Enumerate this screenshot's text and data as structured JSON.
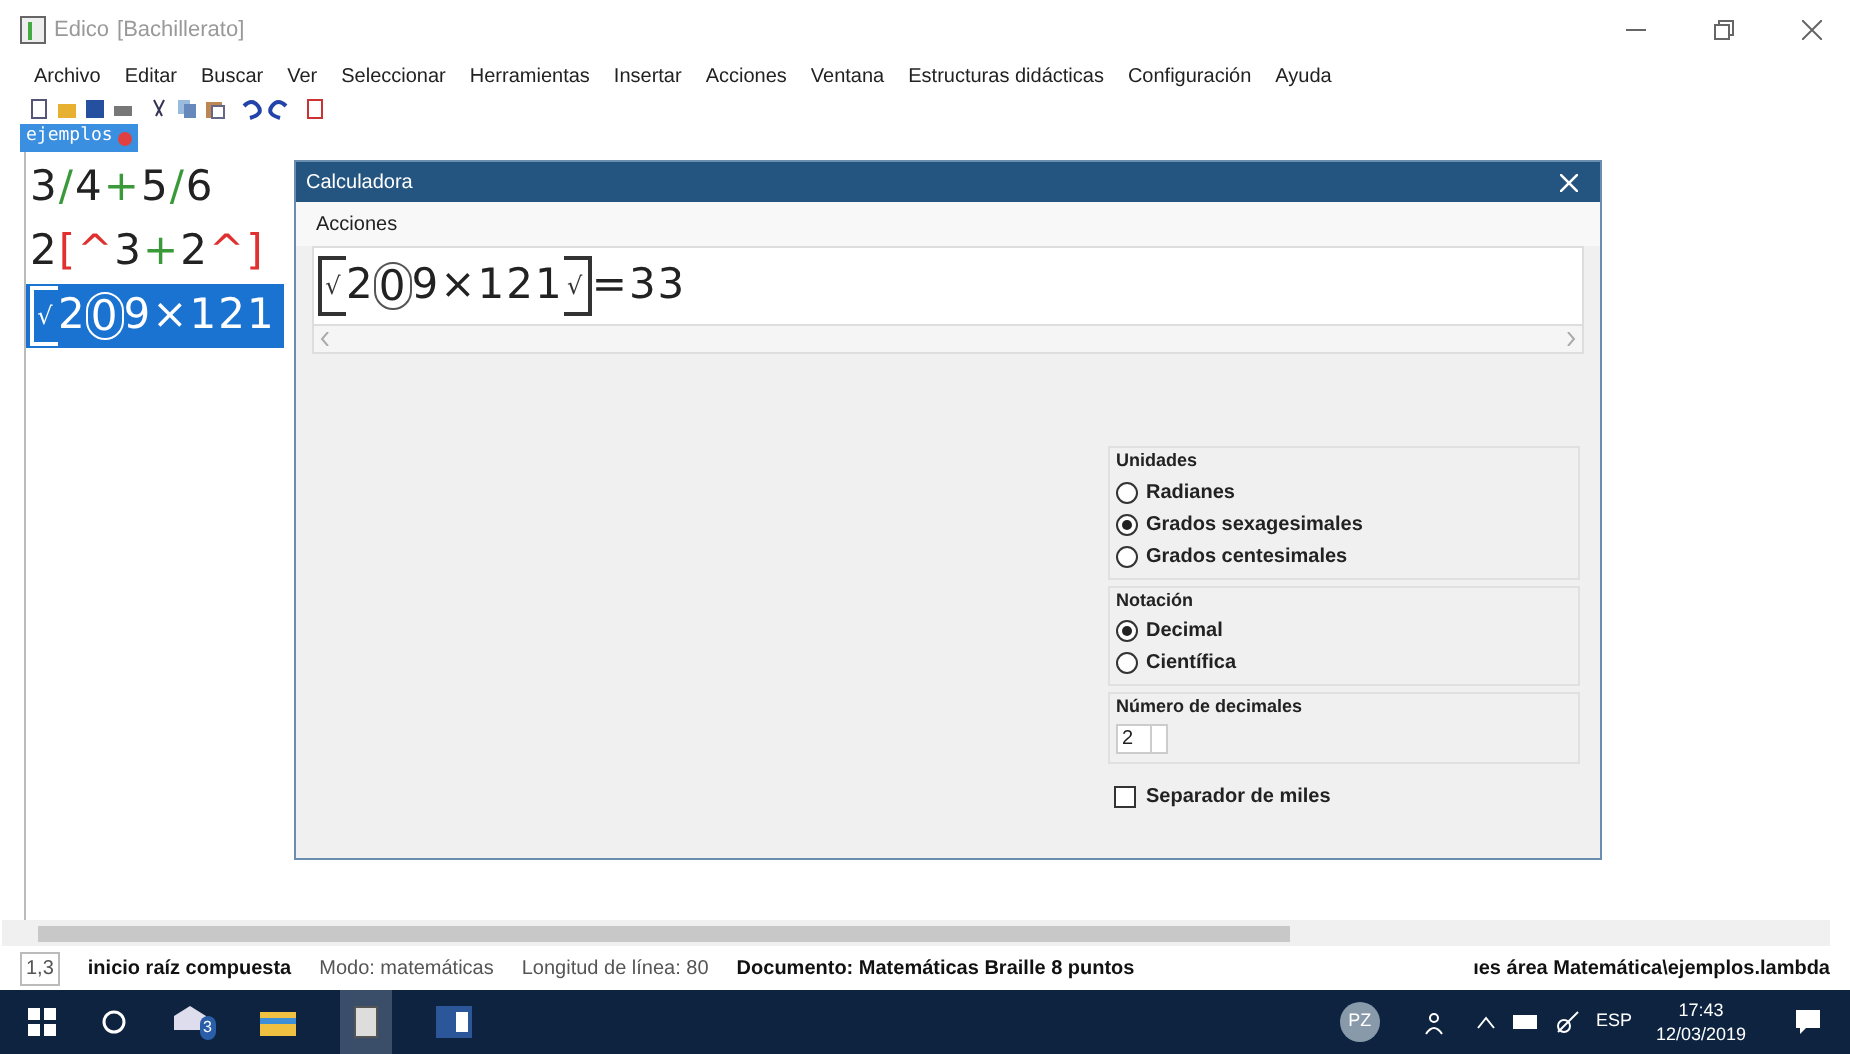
{
  "window": {
    "title": "Edico",
    "subtitle": "[Bachillerato]"
  },
  "menu": [
    "Archivo",
    "Editar",
    "Buscar",
    "Ver",
    "Seleccionar",
    "Herramientas",
    "Insertar",
    "Acciones",
    "Ventana",
    "Estructuras didácticas",
    "Configuración",
    "Ayuda"
  ],
  "tabs": [
    {
      "label": "ejemplos",
      "selected": true
    }
  ],
  "editor_lines": [
    {
      "selected": false,
      "tokens": [
        {
          "kind": "plain",
          "text": "3"
        },
        {
          "kind": "plain",
          "text": "/",
          "color": "#3a9a3a"
        },
        {
          "kind": "plain",
          "text": "4"
        },
        {
          "kind": "plain",
          "text": "+",
          "color": "#3a9a3a"
        },
        {
          "kind": "plain",
          "text": "5"
        },
        {
          "kind": "plain",
          "text": "/",
          "color": "#3a9a3a"
        },
        {
          "kind": "plain",
          "text": "6"
        }
      ]
    },
    {
      "selected": false,
      "tokens": [
        {
          "kind": "plain",
          "text": "2"
        },
        {
          "kind": "plain",
          "text": "[^",
          "color": "#e03030"
        },
        {
          "kind": "plain",
          "text": "3"
        },
        {
          "kind": "plain",
          "text": "+",
          "color": "#3a9a3a"
        },
        {
          "kind": "plain",
          "text": "2"
        },
        {
          "kind": "plain",
          "text": "^]",
          "color": "#e03030"
        }
      ]
    },
    {
      "selected": true,
      "tokens": [
        {
          "kind": "root-open",
          "text": "√"
        },
        {
          "kind": "plain",
          "text": "2"
        },
        {
          "kind": "circled",
          "text": "0"
        },
        {
          "kind": "plain",
          "text": "9"
        },
        {
          "kind": "plain",
          "text": "×"
        },
        {
          "kind": "plain",
          "text": "121"
        }
      ]
    }
  ],
  "calculator": {
    "title": "Calculadora",
    "menu": [
      "Acciones"
    ],
    "expression": [
      {
        "kind": "root-open",
        "text": "√"
      },
      {
        "kind": "plain",
        "text": "2"
      },
      {
        "kind": "circled",
        "text": "0"
      },
      {
        "kind": "plain",
        "text": "9"
      },
      {
        "kind": "plain",
        "text": "×"
      },
      {
        "kind": "plain",
        "text": "121"
      },
      {
        "kind": "root-close",
        "text": "√"
      },
      {
        "kind": "plain",
        "text": "="
      },
      {
        "kind": "plain",
        "text": "33"
      }
    ],
    "units": {
      "title": "Unidades",
      "options": [
        {
          "label": "Radianes",
          "selected": false
        },
        {
          "label": "Grados sexagesimales",
          "selected": true
        },
        {
          "label": "Grados centesimales",
          "selected": false
        }
      ]
    },
    "notation": {
      "title": "Notación",
      "options": [
        {
          "label": "Decimal",
          "selected": true
        },
        {
          "label": "Científica",
          "selected": false
        }
      ]
    },
    "decimals": {
      "title": "Número de decimales",
      "value": "2"
    },
    "thousands_separator": {
      "label": "Separador de miles",
      "checked": false
    }
  },
  "status_bar": [
    {
      "text": "1,3",
      "bold": false,
      "boxed": true
    },
    {
      "text": "inicio raíz compuesta",
      "bold": true,
      "boxed": false
    },
    {
      "text": "Modo: matemáticas",
      "bold": false,
      "boxed": false
    },
    {
      "text": "Longitud de línea: 80",
      "bold": false,
      "boxed": false
    },
    {
      "text": "Documento: Matemáticas  Braille 8 puntos",
      "bold": true,
      "boxed": false
    },
    {
      "text": "ıes área Matemática\\ejemplos.lambda",
      "bold": true,
      "boxed": false
    }
  ],
  "taskbar": {
    "mail_badge": "3",
    "user_initials": "PZ",
    "language": "ESP",
    "time": "17:43",
    "date": "12/03/2019"
  }
}
